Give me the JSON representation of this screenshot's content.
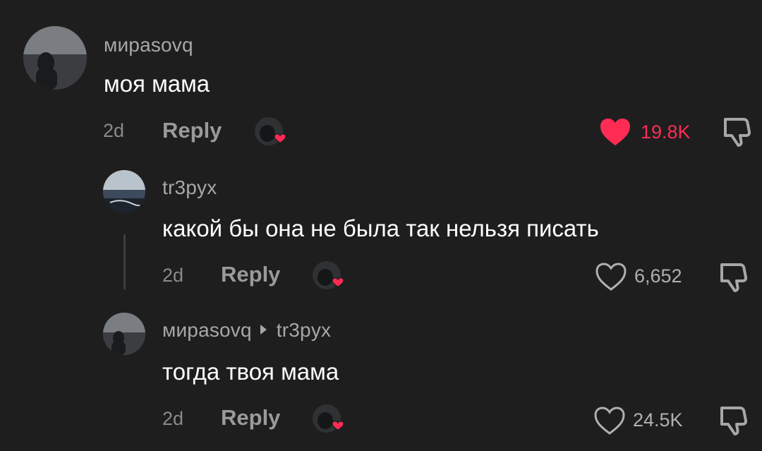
{
  "comments": [
    {
      "username": "мираsovq",
      "text": "моя мама",
      "time": "2d",
      "reply_label": "Reply",
      "likes": "19.8K",
      "liked": true
    },
    {
      "username": "tr3pyx",
      "text": "какой бы она не была так нельзя писать",
      "time": "2d",
      "reply_label": "Reply",
      "likes": "6,652",
      "liked": false
    },
    {
      "username": "мираsovq",
      "reply_to": "tr3pyx",
      "text": "тогда твоя мама",
      "time": "2d",
      "reply_label": "Reply",
      "likes": "24.5K",
      "liked": false
    }
  ],
  "icons": {
    "like": "heart-icon",
    "dislike": "thumbs-down-icon",
    "creator_liked": "creator-liked-badge-icon"
  },
  "colors": {
    "background": "#1e1e1e",
    "like_active": "#fe2c55",
    "secondary_text": "#a7a7a7"
  }
}
